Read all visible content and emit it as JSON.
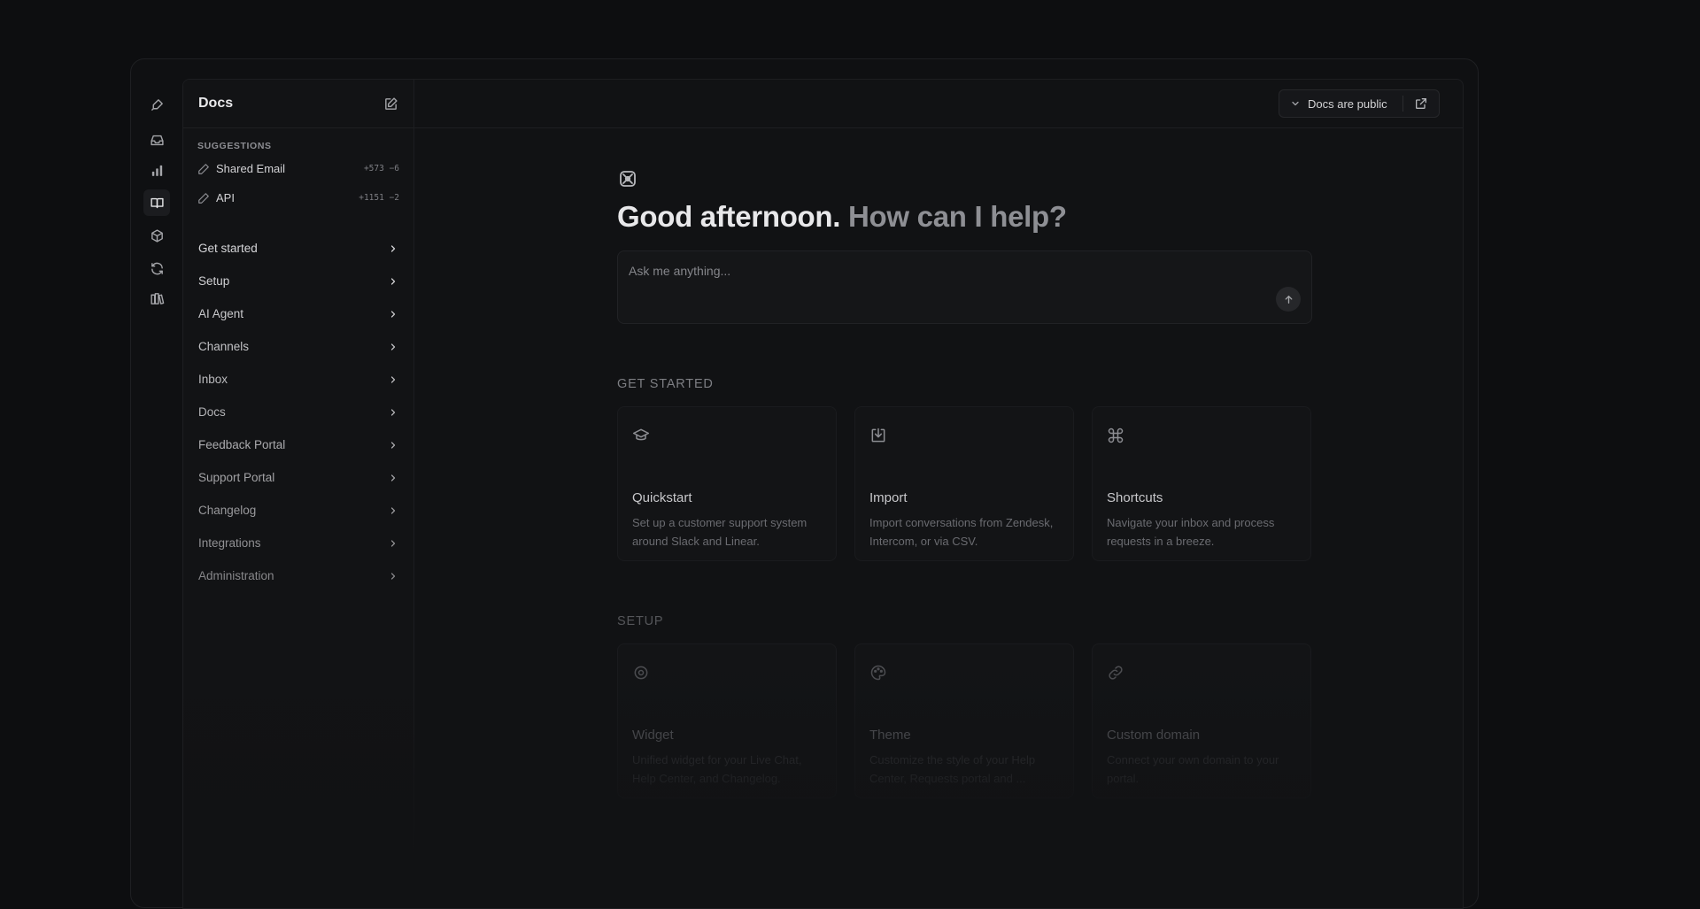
{
  "sidebar": {
    "title": "Docs",
    "suggestions_label": "SUGGESTIONS",
    "suggestions": [
      {
        "label": "Shared Email",
        "diff": "+573 −6"
      },
      {
        "label": "API",
        "diff": "+1151 −2"
      }
    ],
    "nav": [
      {
        "label": "Get started",
        "color": "#d6d6d9"
      },
      {
        "label": "Setup",
        "color": "#d0d0d3"
      },
      {
        "label": "AI Agent",
        "color": "#c9c9cc"
      },
      {
        "label": "Channels",
        "color": "#c2c2c5"
      },
      {
        "label": "Inbox",
        "color": "#bbbbbe"
      },
      {
        "label": "Docs",
        "color": "#b3b3b6"
      },
      {
        "label": "Feedback Portal",
        "color": "#ababae"
      },
      {
        "label": "Support Portal",
        "color": "#a2a2a5"
      },
      {
        "label": "Changelog",
        "color": "#99999c"
      },
      {
        "label": "Integrations",
        "color": "#909093"
      },
      {
        "label": "Administration",
        "color": "#87878a"
      }
    ]
  },
  "header": {
    "visibility_label": "Docs are public"
  },
  "main": {
    "greeting": "Good afternoon.",
    "greeting_secondary": "How can I help?",
    "ask_placeholder": "Ask me anything...",
    "get_started_title": "GET STARTED",
    "setup_title": "SETUP",
    "get_started_cards": [
      {
        "icon": "graduation-cap-icon",
        "title": "Quickstart",
        "desc": "Set up a customer support system around Slack and Linear."
      },
      {
        "icon": "import-icon",
        "title": "Import",
        "desc": "Import conversations from Zendesk, Intercom, or via CSV."
      },
      {
        "icon": "command-icon",
        "title": "Shortcuts",
        "desc": "Navigate your inbox and process requests in a breeze."
      }
    ],
    "setup_cards": [
      {
        "icon": "widget-icon",
        "title": "Widget",
        "desc": "Unified widget for your Live Chat, Help Center, and Changelog."
      },
      {
        "icon": "palette-icon",
        "title": "Theme",
        "desc": "Customize the style of your Help Center, Requests portal and ..."
      },
      {
        "icon": "link-icon",
        "title": "Custom domain",
        "desc": "Connect your own domain to your portal."
      }
    ]
  }
}
